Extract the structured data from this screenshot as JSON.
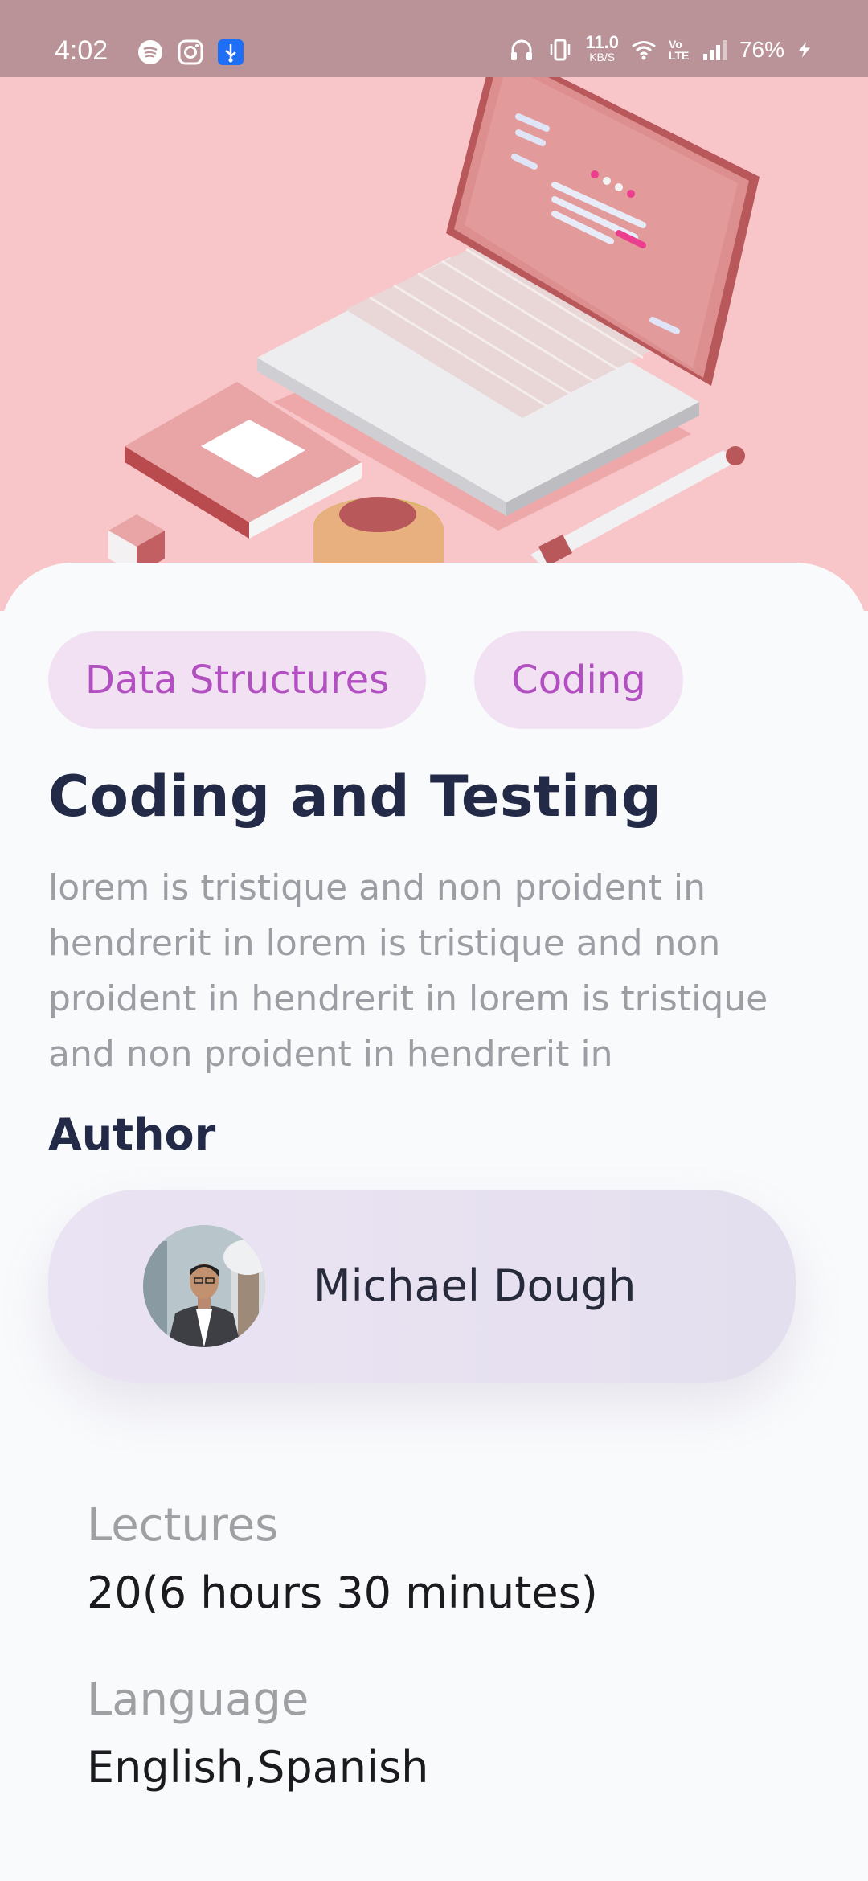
{
  "status_bar": {
    "time": "4:02",
    "left_icons": [
      "spotify-icon",
      "instagram-icon",
      "usb-icon"
    ],
    "right_icons": [
      "headphones-icon",
      "vibrate-icon",
      "wifi-icon",
      "volte-icon",
      "signal-icon",
      "charging-icon"
    ],
    "net_speed_value": "11.0",
    "net_speed_unit": "KB/S",
    "volte": "Vo LTE",
    "battery": "76%"
  },
  "hero": {
    "illustration": "laptop-notebook-pen-illustration"
  },
  "course": {
    "tags": [
      "Data Structures",
      "Coding"
    ],
    "title": "Coding and Testing",
    "description": "lorem is tristique and non proident in hendrerit in lorem is tristique and non proident in hendrerit in lorem is tristique and non proident in hendrerit in",
    "author_heading": "Author",
    "author_name": "Michael Dough",
    "lectures_label": "Lectures",
    "lectures_value": "20(6 hours 30 minutes)",
    "language_label": "Language",
    "language_value": "English,Spanish"
  },
  "colors": {
    "hero_bg": "#f8c6c8",
    "status_bar_bg": "#b99397",
    "chip_bg": "#f1e1f3",
    "chip_text": "#b24fc1",
    "title_text": "#232a47",
    "body_text": "#9d9ea3",
    "author_card_bg": "#e7e1f0"
  }
}
